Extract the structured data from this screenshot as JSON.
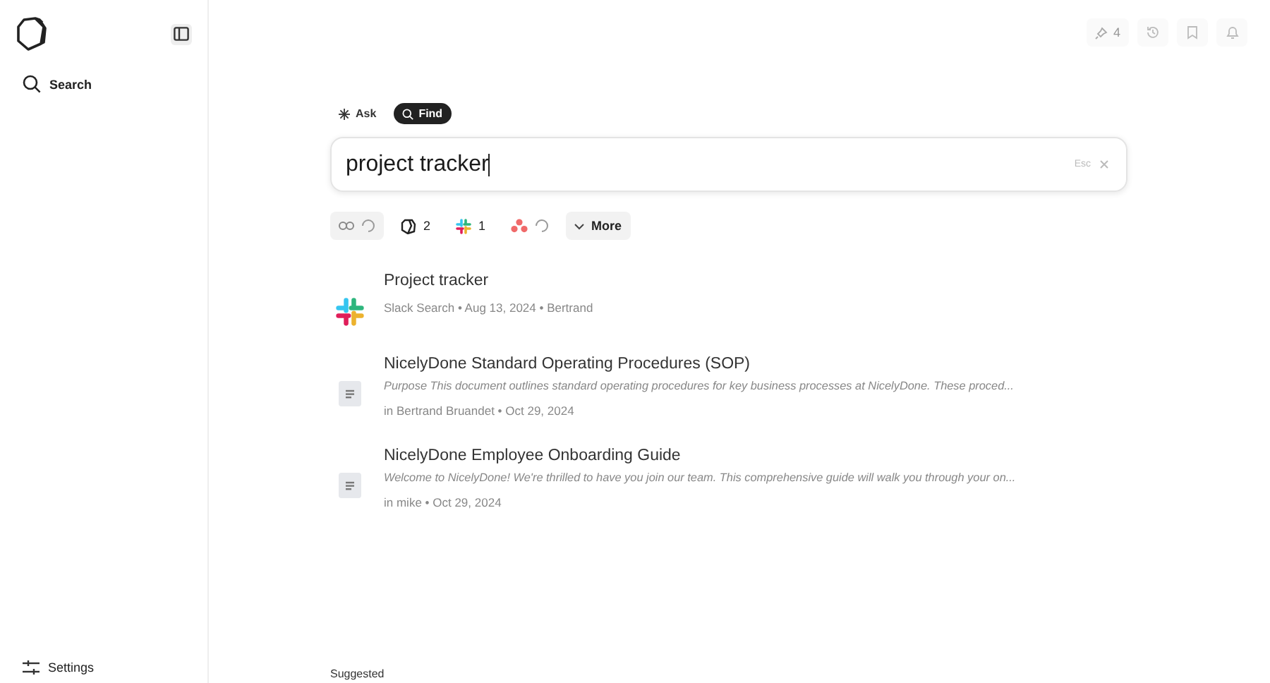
{
  "sidebar": {
    "items": [
      {
        "label": "Search",
        "kind": "search"
      }
    ],
    "footer": {
      "label": "Settings"
    }
  },
  "top_bar": {
    "pin_count": "4"
  },
  "modes": [
    {
      "label": "Ask",
      "kind": "ask",
      "selected": false
    },
    {
      "label": "Find",
      "kind": "find",
      "selected": true
    }
  ],
  "search": {
    "value": "project tracker",
    "hint": "Esc"
  },
  "filters": [
    {
      "kind": "link",
      "loading": true
    },
    {
      "kind": "notion",
      "count": "2",
      "loading": false
    },
    {
      "kind": "slack",
      "count": "1",
      "loading": false
    },
    {
      "kind": "asana",
      "loading": true
    }
  ],
  "more_button": {
    "label": "More"
  },
  "results": [
    {
      "kind": "slack",
      "title": "Project tracker",
      "meta": "Slack Search • Aug 13, 2024 • Bertrand"
    },
    {
      "kind": "doc",
      "title": "NicelyDone Standard Operating Procedures (SOP)",
      "snippet": "Purpose This document outlines standard operating procedures for key business processes at NicelyDone. These proced...",
      "meta": "in Bertrand Bruandet • Oct 29, 2024"
    },
    {
      "kind": "doc",
      "title": "NicelyDone Employee Onboarding Guide",
      "snippet": "Welcome to NicelyDone! We're thrilled to have you join our team. This comprehensive guide will walk you through your on...",
      "meta": "in mike • Oct 29, 2024"
    }
  ],
  "suggested": {
    "heading": "Suggested"
  }
}
